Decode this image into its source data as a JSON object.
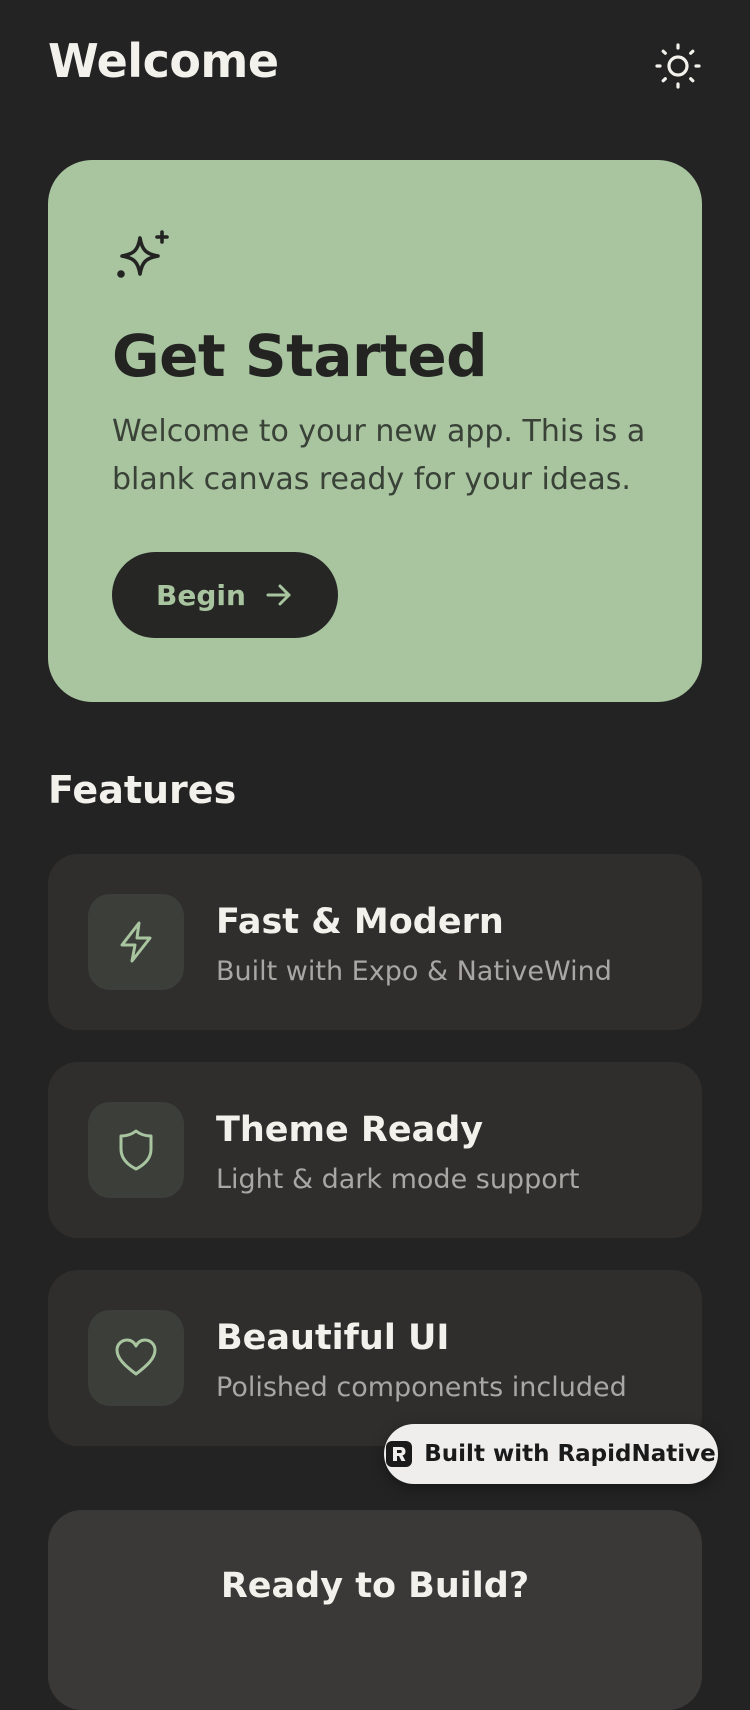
{
  "header": {
    "title": "Welcome",
    "theme_toggle_icon": "sun-icon"
  },
  "hero": {
    "icon": "sparkles-icon",
    "title": "Get Started",
    "description": "Welcome to your new app. This is a blank canvas ready for your ideas.",
    "button_label": "Begin",
    "button_icon": "arrow-right-icon",
    "background_color": "#a8c5a0"
  },
  "features": {
    "title": "Features",
    "items": [
      {
        "title": "Fast & Modern",
        "description": "Built with Expo & NativeWind",
        "icon": "lightning-icon"
      },
      {
        "title": "Theme Ready",
        "description": "Light & dark mode support",
        "icon": "shield-icon"
      },
      {
        "title": "Beautiful UI",
        "description": "Polished components included",
        "icon": "heart-icon"
      }
    ]
  },
  "badge": {
    "label": "Built with RapidNative",
    "icon": "rapidnative-logo-icon"
  },
  "cta": {
    "title": "Ready to Build?"
  },
  "colors": {
    "background": "#242323",
    "card": "#2f2e2d",
    "accent": "#a8c5a0",
    "text_primary": "#f3f1ec",
    "text_secondary": "#a9a7a3"
  }
}
